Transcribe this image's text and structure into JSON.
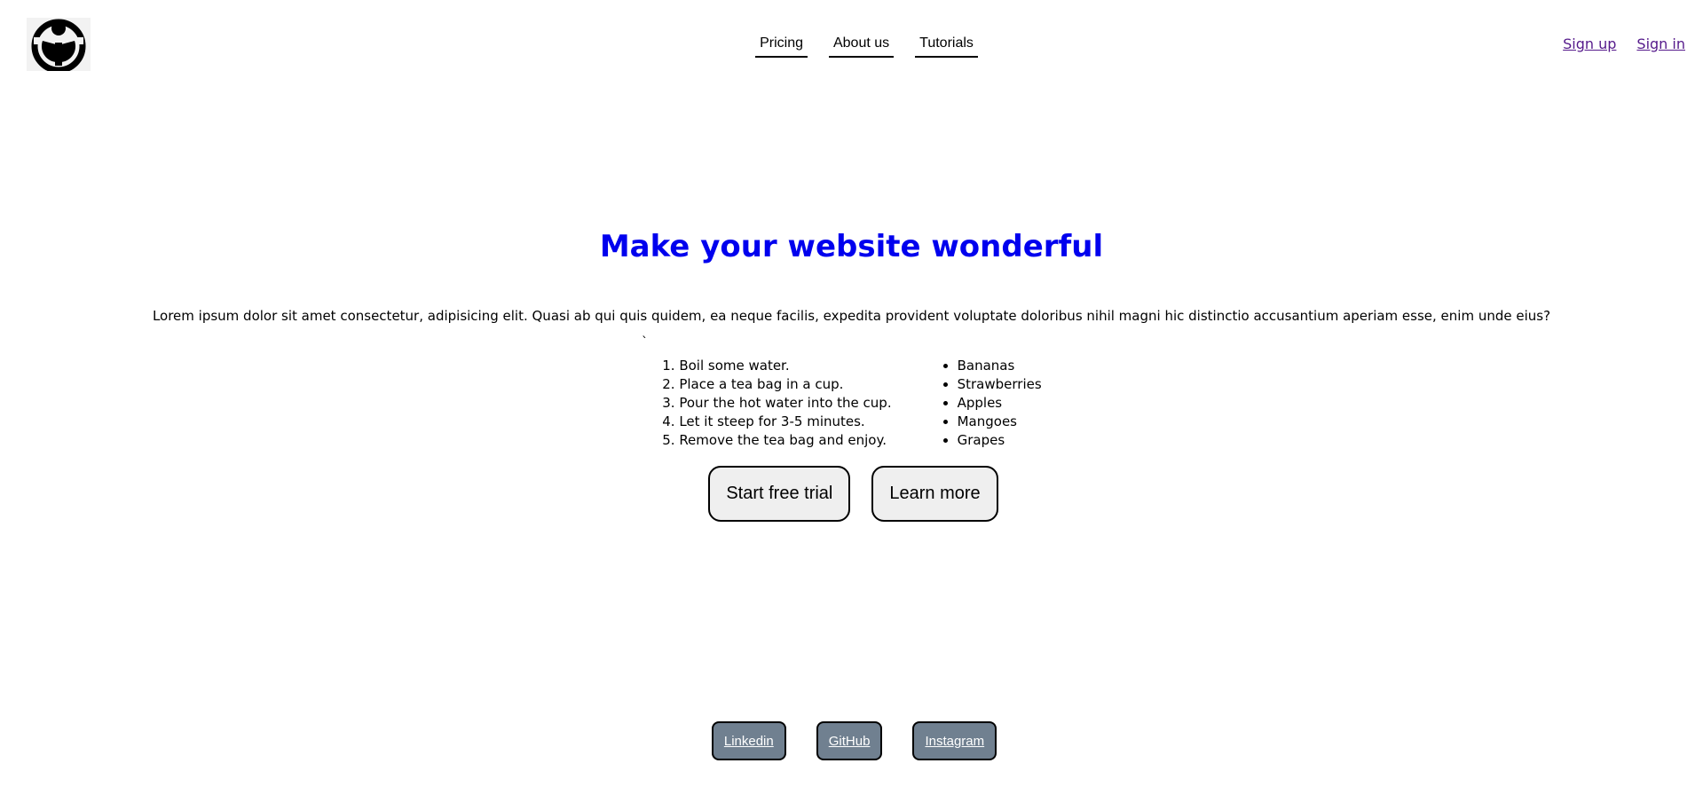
{
  "header": {
    "logo_icon": "wikimedia-logo-icon",
    "nav": [
      {
        "label": "Pricing"
      },
      {
        "label": "About us"
      },
      {
        "label": "Tutorials"
      }
    ],
    "auth": {
      "sign_up": "Sign up",
      "sign_in": "Sign in"
    }
  },
  "hero": {
    "title": "Make your website wonderful",
    "text": "Lorem ipsum dolor sit amet consectetur, adipisicing elit. Quasi ab qui quis quidem, ea neque facilis, expedita provident voluptate doloribus nihil magni hic distinctio accusantium aperiam esse, enim unde eius?",
    "stray_mark": "`"
  },
  "steps": [
    "Boil some water.",
    "Place a tea bag in a cup.",
    "Pour the hot water into the cup.",
    "Let it steep for 3-5 minutes.",
    "Remove the tea bag and enjoy."
  ],
  "fruits": [
    "Bananas",
    "Strawberries",
    "Apples",
    "Mangoes",
    "Grapes"
  ],
  "cta": {
    "primary": "Start free trial",
    "secondary": "Learn more"
  },
  "social": [
    {
      "label": "Linkedin"
    },
    {
      "label": "GitHub"
    },
    {
      "label": "Instagram"
    }
  ],
  "colors": {
    "title": "#0000ee",
    "visited_link": "#551a8b",
    "social_bg": "#708090",
    "button_bg": "#efefef"
  }
}
